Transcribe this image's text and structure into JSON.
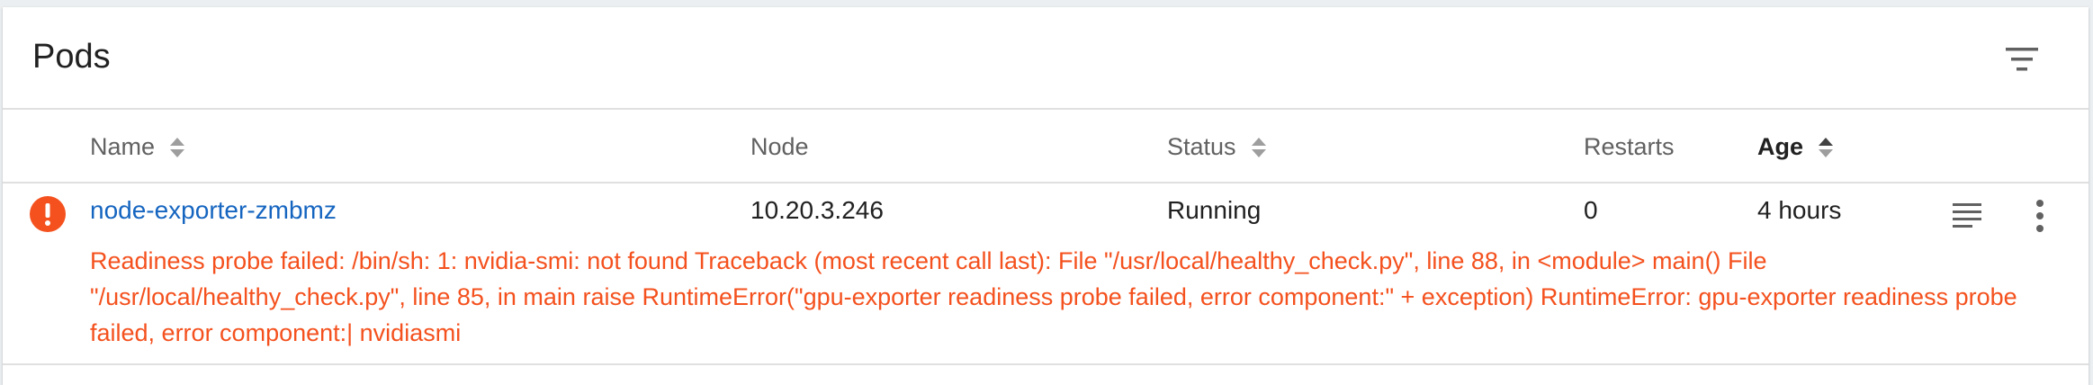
{
  "card": {
    "title": "Pods"
  },
  "table": {
    "columns": [
      {
        "label": "Name",
        "sortable": true
      },
      {
        "label": "Node",
        "sortable": false
      },
      {
        "label": "Status",
        "sortable": true
      },
      {
        "label": "Restarts",
        "sortable": false
      },
      {
        "label": "Age",
        "sortable": true,
        "active": true
      }
    ],
    "rows": [
      {
        "name": "node-exporter-zmbmz",
        "node": "10.20.3.246",
        "status": "Running",
        "restarts": "0",
        "age": "4 hours",
        "message": "Readiness probe failed: /bin/sh: 1: nvidia-smi: not found Traceback (most recent call last): File \"/usr/local/healthy_check.py\", line 88, in <module> main() File \"/usr/local/healthy_check.py\", line 85, in main raise RuntimeError(\"gpu-exporter readiness probe failed, error component:\" + exception) RuntimeError: gpu-exporter readiness probe failed, error component:| nvidiasmi"
      }
    ]
  },
  "colors": {
    "error": "#f4511e",
    "link": "#1565c0"
  },
  "icons": {
    "filter": "filter-list-icon",
    "error": "error-icon",
    "logs": "logs-icon",
    "more": "more-vert-icon",
    "sort": "sort-icon"
  }
}
